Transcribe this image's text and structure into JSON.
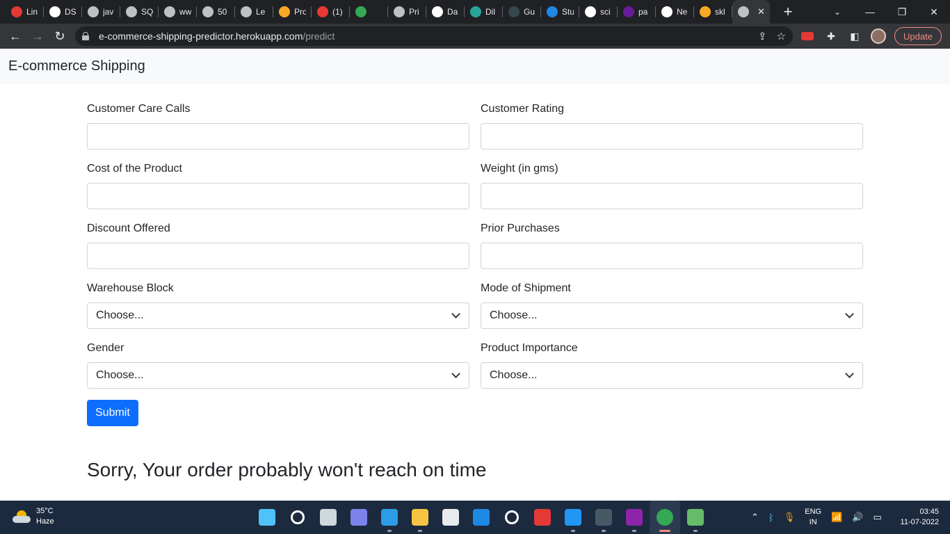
{
  "browser": {
    "tabs": [
      {
        "title": "Lin",
        "favicon_color": "#e53935",
        "favicon_icon": "youtube-icon"
      },
      {
        "title": "DS",
        "favicon_color": "#ffffff",
        "favicon_icon": "github-icon"
      },
      {
        "title": "jav",
        "favicon_color": "#bdc1c6",
        "favicon_icon": "globe-icon"
      },
      {
        "title": "SQ",
        "favicon_color": "#bdc1c6",
        "favicon_icon": "globe-icon"
      },
      {
        "title": "ww",
        "favicon_color": "#bdc1c6",
        "favicon_icon": "globe-icon"
      },
      {
        "title": "50",
        "favicon_color": "#bdc1c6",
        "favicon_icon": "globe-icon"
      },
      {
        "title": "Le",
        "favicon_color": "#bdc1c6",
        "favicon_icon": "globe-icon"
      },
      {
        "title": "Pro",
        "favicon_color": "#f9a825",
        "favicon_icon": "amazon-icon"
      },
      {
        "title": "(1)",
        "favicon_color": "#e53935",
        "favicon_icon": "youtube-icon"
      },
      {
        "title": "",
        "favicon_color": "#34a853",
        "favicon_icon": "meet-icon"
      },
      {
        "title": "Pri",
        "favicon_color": "#bdc1c6",
        "favicon_icon": "globe-icon"
      },
      {
        "title": "Da",
        "favicon_color": "#ffffff",
        "favicon_icon": "medium-icon"
      },
      {
        "title": "Dil",
        "favicon_color": "#26a69a",
        "favicon_icon": "app-icon"
      },
      {
        "title": "Gu",
        "favicon_color": "#37474f",
        "favicon_icon": "tds-icon"
      },
      {
        "title": "Stu",
        "favicon_color": "#1e88e5",
        "favicon_icon": "k-icon"
      },
      {
        "title": "sci",
        "favicon_color": "#ffffff",
        "favicon_icon": "github-icon"
      },
      {
        "title": "pa",
        "favicon_color": "#6a1b9a",
        "favicon_icon": "app-icon"
      },
      {
        "title": "Ne",
        "favicon_color": "#ffffff",
        "favicon_icon": "chrome-icon"
      },
      {
        "title": "skl",
        "favicon_color": "#f9a825",
        "favicon_icon": "app-icon"
      },
      {
        "title": "",
        "favicon_color": "#bdc1c6",
        "favicon_icon": "globe-icon",
        "active": true
      }
    ],
    "url_host": "e-commerce-shipping-predictor.herokuapp.com",
    "url_path": "/predict",
    "update_label": "Update"
  },
  "page": {
    "brand": "E-commerce Shipping",
    "fields": [
      {
        "label": "Customer Care Calls",
        "type": "input",
        "value": ""
      },
      {
        "label": "Customer Rating",
        "type": "input",
        "value": ""
      },
      {
        "label": "Cost of the Product",
        "type": "input",
        "value": ""
      },
      {
        "label": "Weight (in gms)",
        "type": "input",
        "value": ""
      },
      {
        "label": "Discount Offered",
        "type": "input",
        "value": ""
      },
      {
        "label": "Prior Purchases",
        "type": "input",
        "value": ""
      },
      {
        "label": "Warehouse Block",
        "type": "select",
        "value": "Choose..."
      },
      {
        "label": "Mode of Shipment",
        "type": "select",
        "value": "Choose..."
      },
      {
        "label": "Gender",
        "type": "select",
        "value": "Choose..."
      },
      {
        "label": "Product Importance",
        "type": "select",
        "value": "Choose..."
      }
    ],
    "submit_label": "Submit",
    "result_text": "Sorry, Your order probably won't reach on time"
  },
  "taskbar": {
    "temperature": "35°C",
    "weather": "Haze",
    "language_line1": "ENG",
    "language_line2": "IN",
    "time": "03:45",
    "date": "11-07-2022",
    "apps": [
      {
        "name": "start-icon",
        "color": "#4fc3f7"
      },
      {
        "name": "search-icon",
        "color": "#ffffff"
      },
      {
        "name": "task-view-icon",
        "color": "#cfd8dc"
      },
      {
        "name": "teams-chat-icon",
        "color": "#7b83eb"
      },
      {
        "name": "edge-icon",
        "color": "#2b9de8"
      },
      {
        "name": "file-explorer-icon",
        "color": "#f6c343"
      },
      {
        "name": "store-icon",
        "color": "#e8eaed"
      },
      {
        "name": "mail-icon",
        "color": "#1e88e5"
      },
      {
        "name": "pycharm-icon",
        "color": "#ffffff"
      },
      {
        "name": "app-red-icon",
        "color": "#e53935"
      },
      {
        "name": "vscode-icon",
        "color": "#2196f3"
      },
      {
        "name": "mysql-icon",
        "color": "#455a64"
      },
      {
        "name": "intellij-icon",
        "color": "#8e24aa"
      },
      {
        "name": "chrome-icon",
        "color": "#34a853"
      },
      {
        "name": "git-icon",
        "color": "#66bb6a"
      }
    ]
  }
}
